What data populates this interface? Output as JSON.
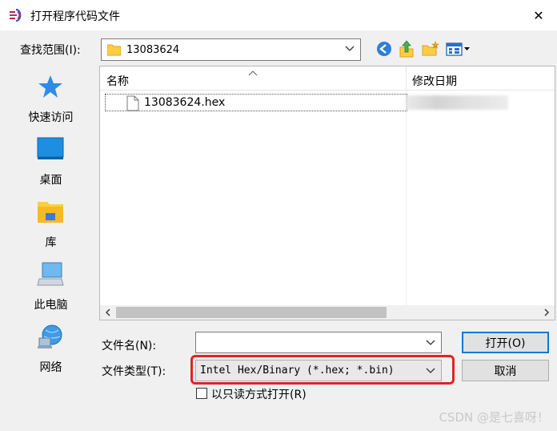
{
  "window": {
    "title": "打开程序代码文件",
    "close_glyph": "✕"
  },
  "toolbar": {
    "look_in_label": "查找范围(I):",
    "look_in_value": "13083624",
    "back_icon": "back-arrow-icon",
    "up_icon": "up-folder-icon",
    "new_folder_icon": "new-folder-icon",
    "view_menu_icon": "view-menu-icon"
  },
  "places": [
    {
      "label": "快速访问",
      "icon": "quick-access-star-icon"
    },
    {
      "label": "桌面",
      "icon": "desktop-icon"
    },
    {
      "label": "库",
      "icon": "library-icon"
    },
    {
      "label": "此电脑",
      "icon": "computer-icon"
    },
    {
      "label": "网络",
      "icon": "network-icon"
    }
  ],
  "filelist": {
    "columns": [
      "名称",
      "修改日期"
    ],
    "files": [
      {
        "name": "13083624.hex"
      }
    ]
  },
  "form": {
    "filename_label": "文件名(N):",
    "filename_value": "",
    "filetype_label": "文件类型(T):",
    "filetype_value": "Intel Hex/Binary (*.hex; *.bin)",
    "readonly_label": "以只读方式打开(R)",
    "open_button": "打开(O)",
    "cancel_button": "取消"
  },
  "colors": {
    "highlight": "#e02424",
    "accent": "#0078d7"
  },
  "watermark": "CSDN @是七喜呀！"
}
